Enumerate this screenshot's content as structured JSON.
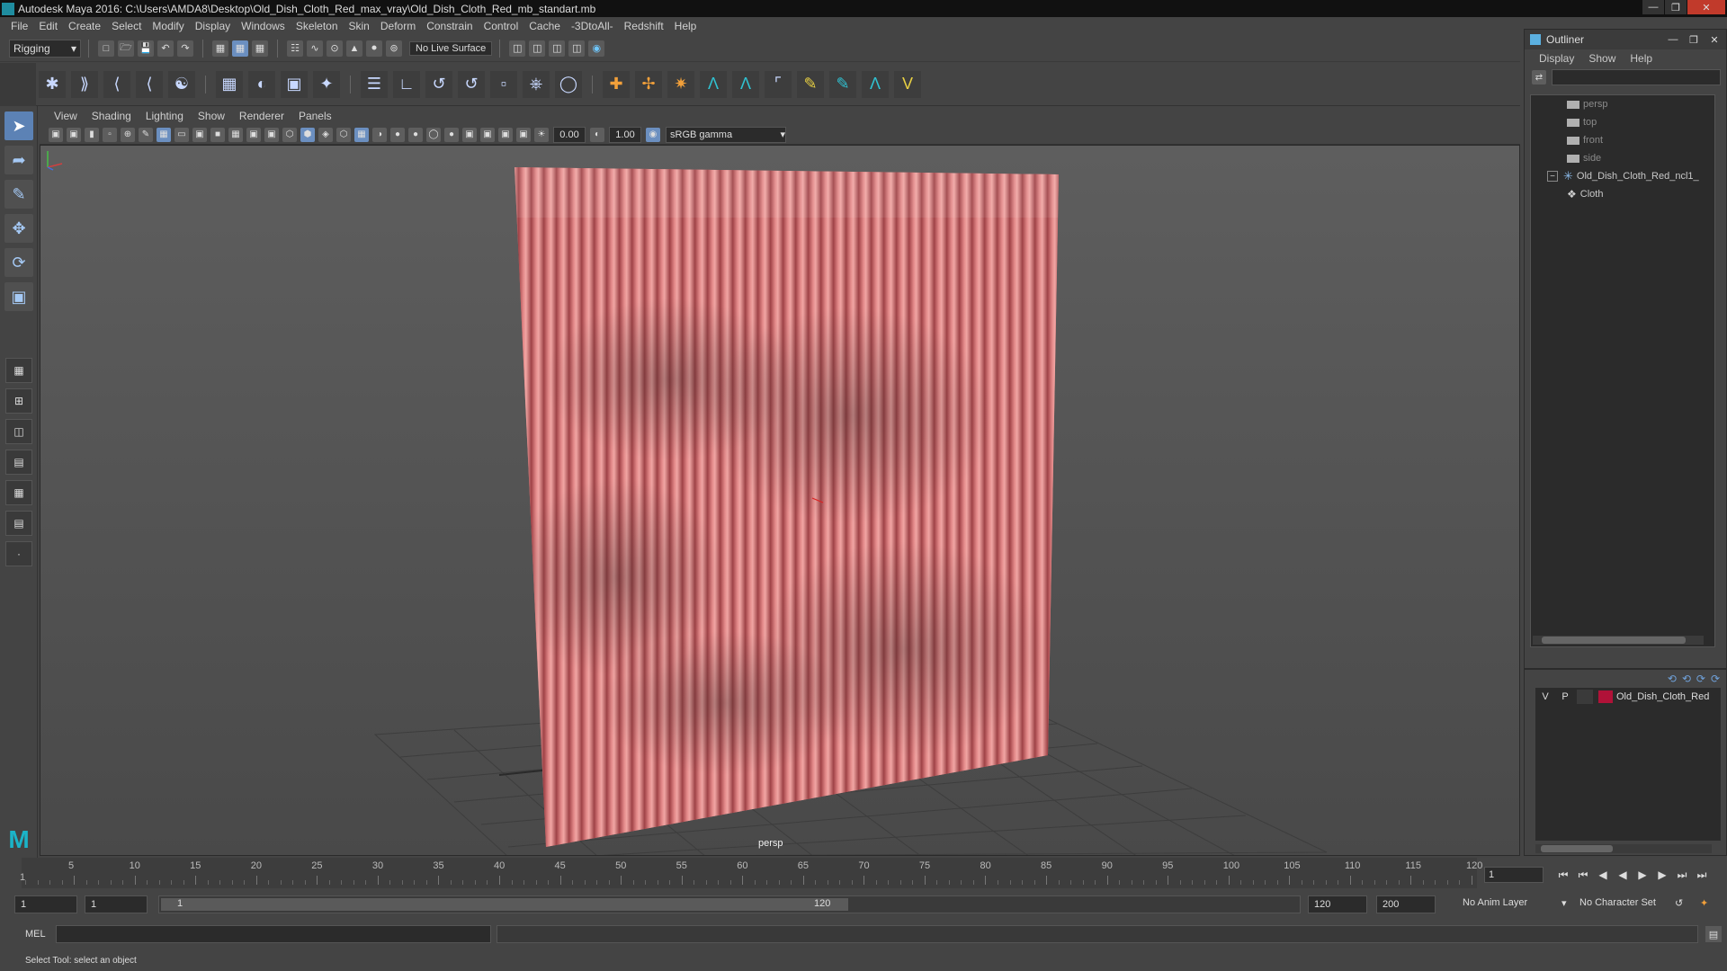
{
  "window": {
    "title": "Autodesk Maya 2016: C:\\Users\\AMDA8\\Desktop\\Old_Dish_Cloth_Red_max_vray\\Old_Dish_Cloth_Red_mb_standart.mb"
  },
  "main_menu": [
    "File",
    "Edit",
    "Create",
    "Select",
    "Modify",
    "Display",
    "Windows",
    "Skeleton",
    "Skin",
    "Deform",
    "Constrain",
    "Control",
    "Cache",
    "-3DtoAll-",
    "Redshift",
    "Help"
  ],
  "status_line": {
    "menu_set": "Rigging",
    "live_surface": "No Live Surface"
  },
  "viewport": {
    "menu": [
      "View",
      "Shading",
      "Lighting",
      "Show",
      "Renderer",
      "Panels"
    ],
    "exposure": "0.00",
    "gamma": "1.00",
    "color_space": "sRGB gamma",
    "camera_label": "persp"
  },
  "outliner": {
    "title": "Outliner",
    "menu": [
      "Display",
      "Show",
      "Help"
    ],
    "items": [
      {
        "label": "persp",
        "type": "camera",
        "dim": true
      },
      {
        "label": "top",
        "type": "camera",
        "dim": true
      },
      {
        "label": "front",
        "type": "camera",
        "dim": true
      },
      {
        "label": "side",
        "type": "camera",
        "dim": true
      },
      {
        "label": "Old_Dish_Cloth_Red_ncl1_",
        "type": "group",
        "expanded": true
      },
      {
        "label": "Cloth",
        "type": "mesh",
        "child": true
      }
    ]
  },
  "layer_editor": {
    "layers": [
      {
        "visible": "V",
        "playback": "P",
        "color": "#b01238",
        "name": "Old_Dish_Cloth_Red"
      }
    ]
  },
  "timeline": {
    "ticks": [
      5,
      10,
      15,
      20,
      25,
      30,
      35,
      40,
      45,
      50,
      55,
      60,
      65,
      70,
      75,
      80,
      85,
      90,
      95,
      100,
      105,
      110,
      115,
      120
    ],
    "start_tick": "1",
    "current_frame": "1"
  },
  "range": {
    "start": "1",
    "playback_start": "1",
    "range_start_label": "1",
    "range_end_label": "120",
    "playback_end": "120",
    "end": "200",
    "anim_layer": "No Anim Layer",
    "character_set": "No Character Set"
  },
  "command_line": {
    "label": "MEL"
  },
  "help_line": "Select Tool: select an object",
  "colors": {
    "cloth": "#d06a6c",
    "layer_swatch": "#b01238",
    "maya_accent": "#1bb4c8"
  }
}
